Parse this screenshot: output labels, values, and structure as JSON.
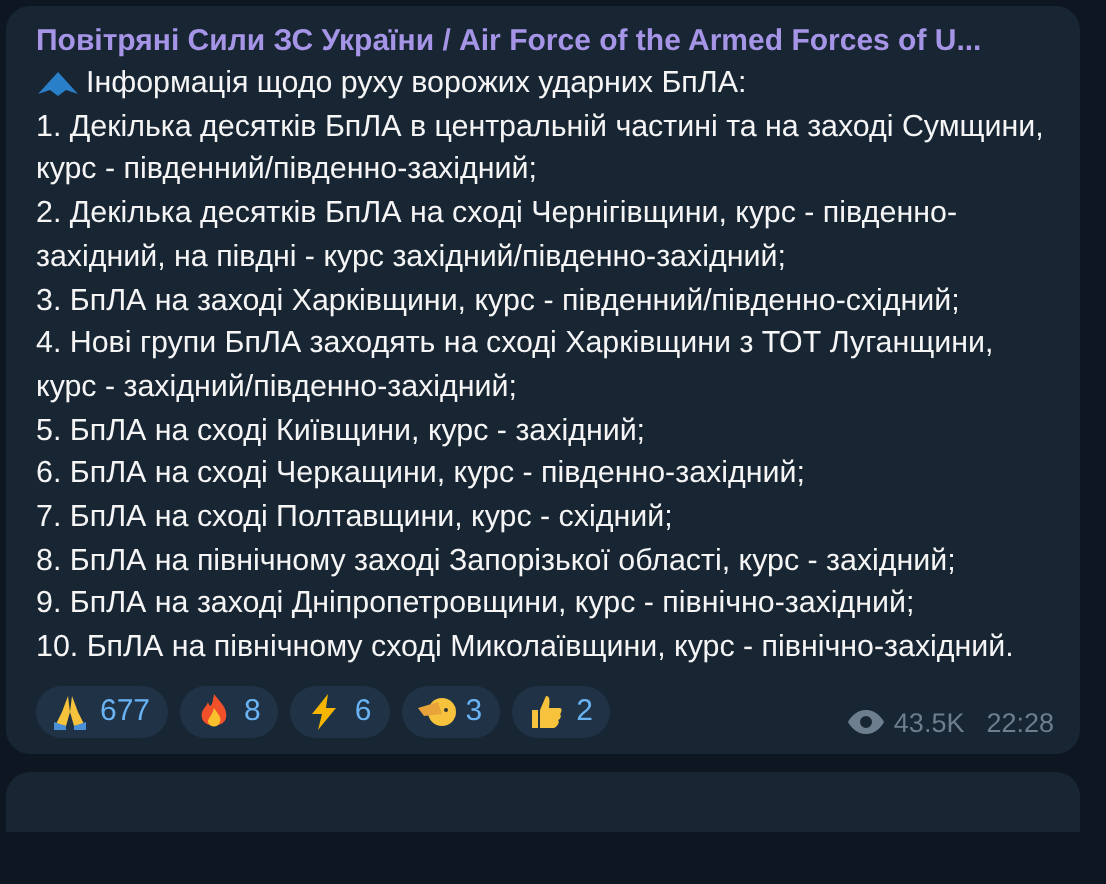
{
  "message": {
    "channel": "Повітряні Сили ЗС України / Air Force of the Armed Forces of U...",
    "intro": "Інформація щодо руху ворожих ударних БпЛА:",
    "items": [
      "1. Декілька десятків БпЛА в центральній частині та на заході Сумщини, курс - південний/південно-західний;",
      "2. Декілька десятків БпЛА на сході Чернігівщини, курс - південно-західний, на півдні - курс західний/південно-західний;",
      "3. БпЛА на заході Харківщини, курс - південний/південно-східний;",
      "4. Нові групи БпЛА заходять на сході Харківщини з ТОТ Луганщини, курс - західний/південно-західний;",
      "5. БпЛА на сході Київщини, курс - західний;",
      "6. БпЛА на сході Черкащини, курс - південно-західний;",
      "7. БпЛА на сході Полтавщини, курс - східний;",
      "8. БпЛА на північному заході Запорізької області, курс - західний;",
      "9. БпЛА на заході Дніпропетровщини, курс - північно-західний;",
      "10. БпЛА на північному сході Миколаївщини, курс - північно-західний."
    ],
    "reactions": [
      {
        "kind": "pray",
        "count": "677"
      },
      {
        "kind": "fire",
        "count": "8"
      },
      {
        "kind": "zap",
        "count": "6"
      },
      {
        "kind": "salute",
        "count": "3"
      },
      {
        "kind": "thumbs",
        "count": "2"
      }
    ],
    "views": "43.5K",
    "time": "22:28"
  }
}
